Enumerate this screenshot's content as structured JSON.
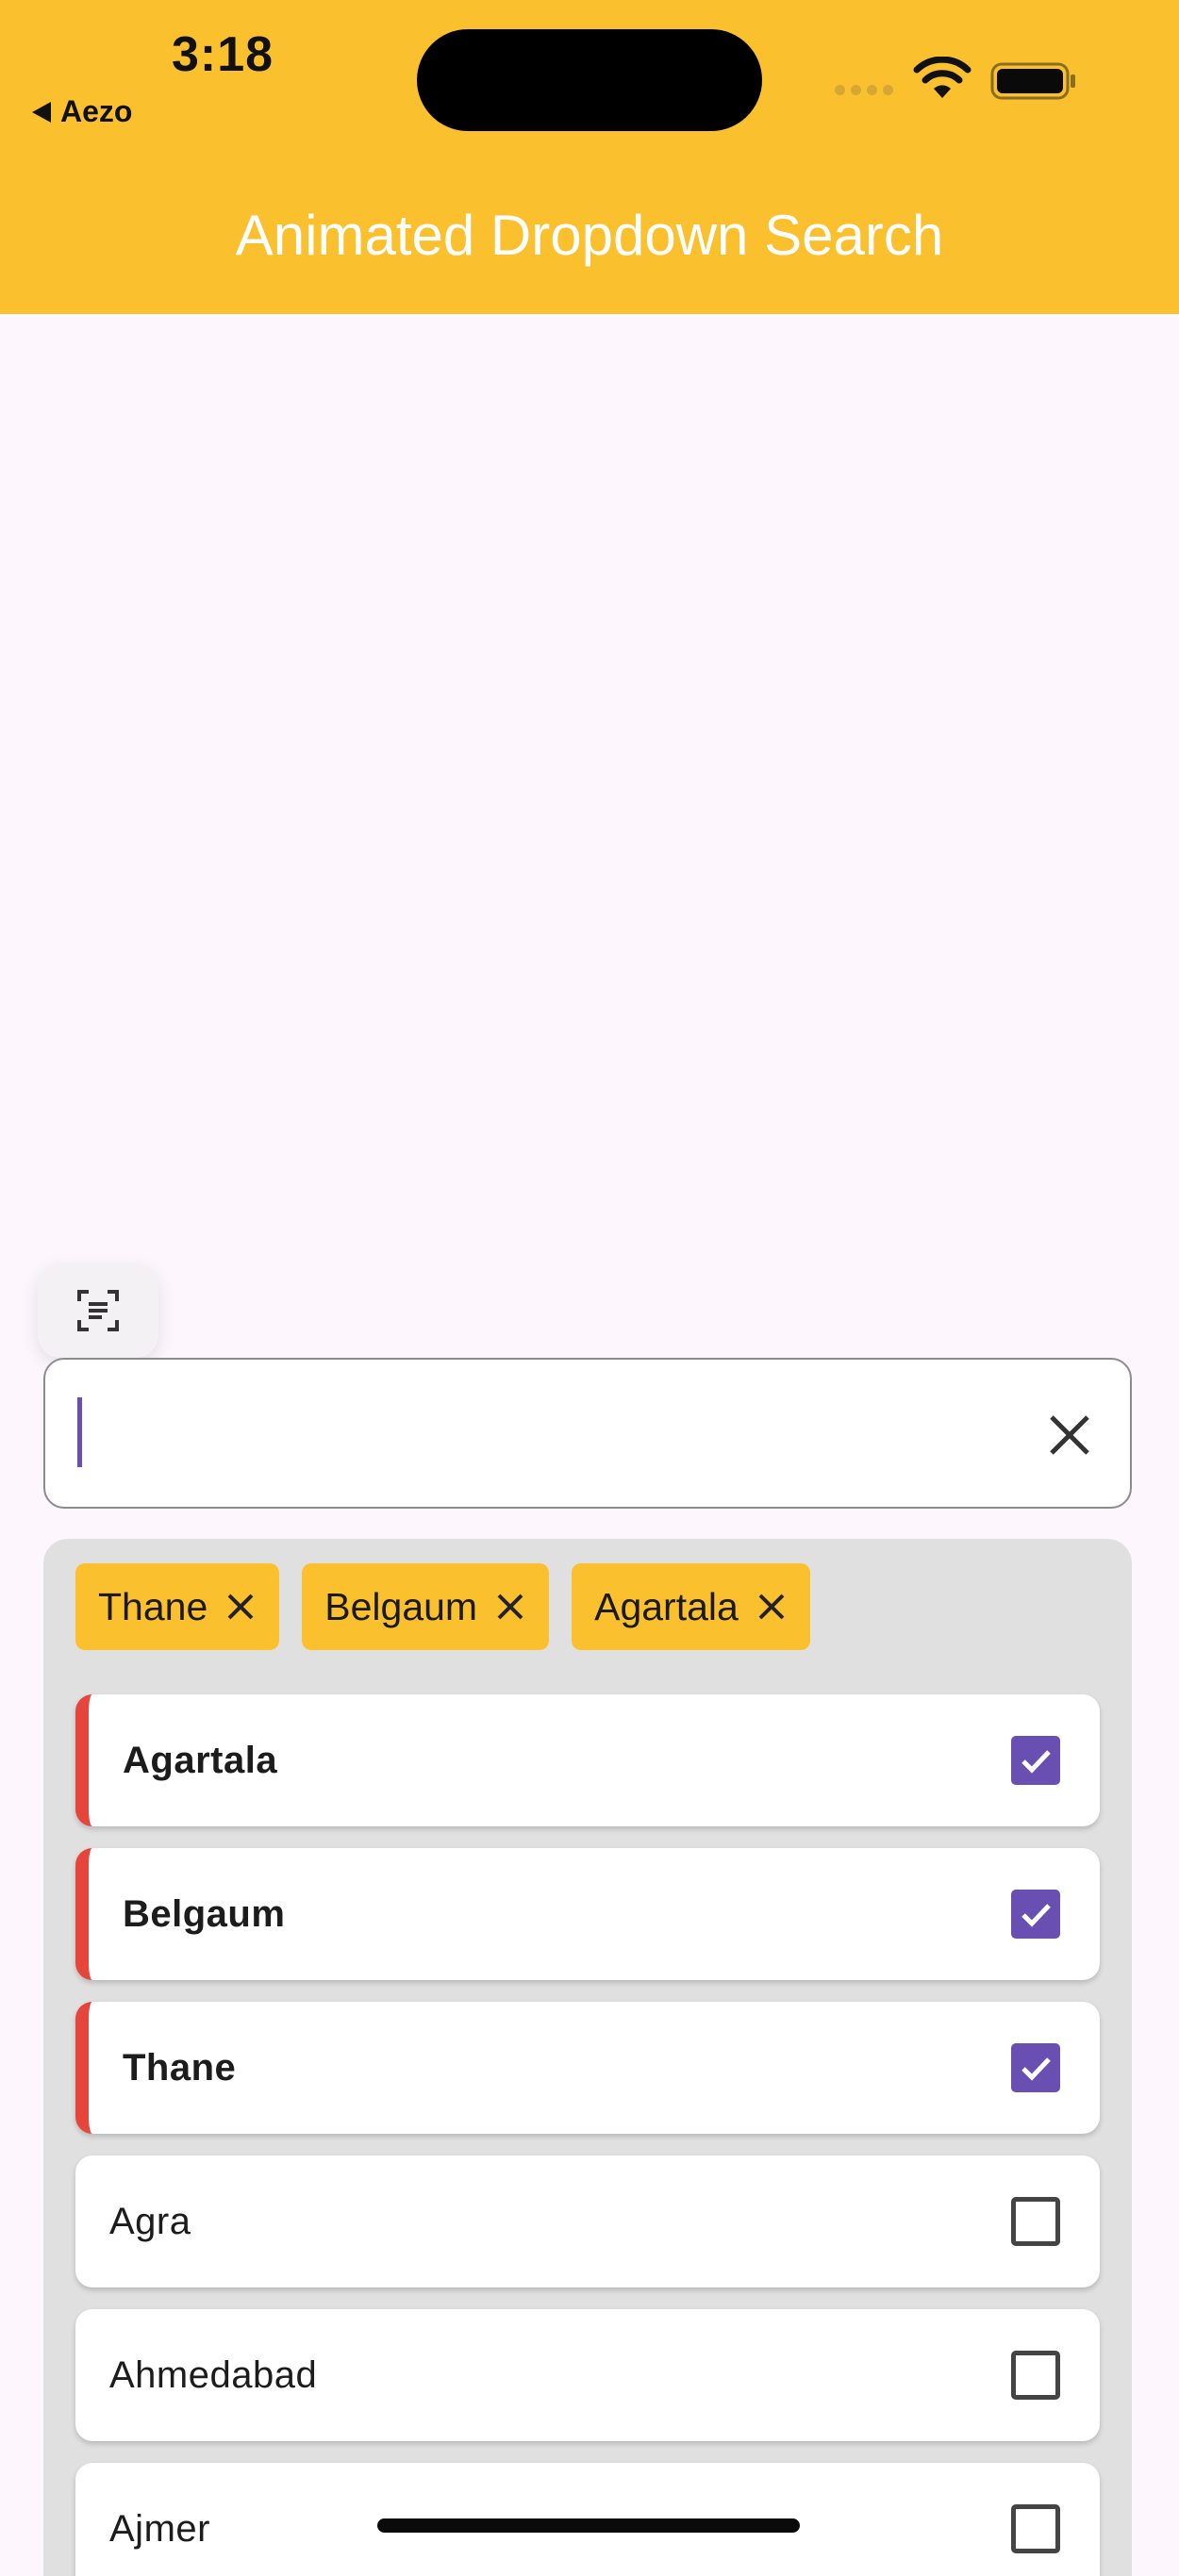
{
  "status_bar": {
    "time": "3:18",
    "back_label": "Aezo"
  },
  "app_bar": {
    "title": "Animated Dropdown Search"
  },
  "search": {
    "value": "",
    "placeholder": ""
  },
  "selected_chips": [
    {
      "label": "Thane"
    },
    {
      "label": "Belgaum"
    },
    {
      "label": "Agartala"
    }
  ],
  "options": [
    {
      "label": "Agartala",
      "checked": true
    },
    {
      "label": "Belgaum",
      "checked": true
    },
    {
      "label": "Thane",
      "checked": true
    },
    {
      "label": "Agra",
      "checked": false
    },
    {
      "label": "Ahmedabad",
      "checked": false
    },
    {
      "label": "Ajmer",
      "checked": false
    }
  ],
  "colors": {
    "accent": "#fbc02d",
    "checkbox": "#6a4fb3",
    "selected_marker": "#e5453a"
  }
}
